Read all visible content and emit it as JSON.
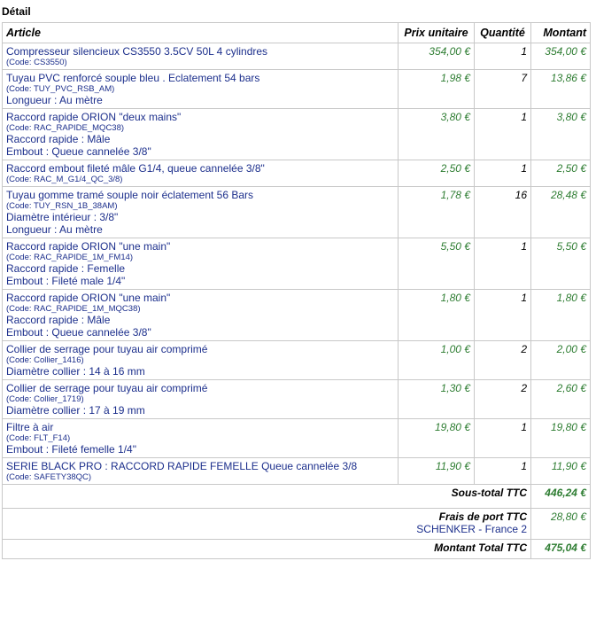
{
  "section_title": "Détail",
  "headers": {
    "article": "Article",
    "unit_price": "Prix unitaire",
    "quantity": "Quantité",
    "amount": "Montant"
  },
  "items": [
    {
      "name": "Compresseur silencieux CS3550 3.5CV 50L 4 cylindres",
      "code": "(Code: CS3550)",
      "attrs": [],
      "price": "354,00 €",
      "qty": "1",
      "amount": "354,00 €"
    },
    {
      "name": "Tuyau PVC renforcé souple bleu . Eclatement 54 bars",
      "code": "(Code: TUY_PVC_RSB_AM)",
      "attrs": [
        "Longueur : Au mètre"
      ],
      "price": "1,98 €",
      "qty": "7",
      "amount": "13,86 €"
    },
    {
      "name": "Raccord rapide ORION \"deux mains\"",
      "code": "(Code: RAC_RAPIDE_MQC38)",
      "attrs": [
        "Raccord rapide : Mâle",
        "Embout : Queue cannelée 3/8\""
      ],
      "price": "3,80 €",
      "qty": "1",
      "amount": "3,80 €"
    },
    {
      "name": "Raccord embout fileté mâle G1/4, queue cannelée 3/8\"",
      "code": "(Code: RAC_M_G1/4_QC_3/8)",
      "attrs": [],
      "price": "2,50 €",
      "qty": "1",
      "amount": "2,50 €"
    },
    {
      "name": "Tuyau gomme tramé souple noir éclatement 56 Bars",
      "code": "(Code: TUY_RSN_1B_38AM)",
      "attrs": [
        "Diamètre intérieur : 3/8\"",
        "Longueur : Au mètre"
      ],
      "price": "1,78 €",
      "qty": "16",
      "amount": "28,48 €"
    },
    {
      "name": "Raccord rapide ORION \"une main\"",
      "code": "(Code: RAC_RAPIDE_1M_FM14)",
      "attrs": [
        "Raccord rapide : Femelle",
        "Embout : Fileté male 1/4\""
      ],
      "price": "5,50 €",
      "qty": "1",
      "amount": "5,50 €"
    },
    {
      "name": "Raccord rapide ORION \"une main\"",
      "code": "(Code: RAC_RAPIDE_1M_MQC38)",
      "attrs": [
        "Raccord rapide : Mâle",
        "Embout : Queue cannelée 3/8\""
      ],
      "price": "1,80 €",
      "qty": "1",
      "amount": "1,80 €"
    },
    {
      "name": "Collier de serrage pour tuyau air comprimé",
      "code": "(Code: Collier_1416)",
      "attrs": [
        "Diamètre collier : 14 à 16 mm"
      ],
      "price": "1,00 €",
      "qty": "2",
      "amount": "2,00 €"
    },
    {
      "name": "Collier de serrage pour tuyau air comprimé",
      "code": "(Code: Collier_1719)",
      "attrs": [
        "Diamètre collier : 17 à 19 mm"
      ],
      "price": "1,30 €",
      "qty": "2",
      "amount": "2,60 €"
    },
    {
      "name": "Filtre à air",
      "code": "(Code: FLT_F14)",
      "attrs": [
        "Embout : Fileté femelle 1/4\""
      ],
      "price": "19,80 €",
      "qty": "1",
      "amount": "19,80 €"
    },
    {
      "name": "SERIE BLACK PRO : RACCORD RAPIDE FEMELLE Queue cannelée 3/8",
      "code": "(Code: SAFETY38QC)",
      "attrs": [],
      "price": "11,90 €",
      "qty": "1",
      "amount": "11,90 €"
    }
  ],
  "subtotal": {
    "label": "Sous-total TTC",
    "value": "446,24 €"
  },
  "shipping": {
    "label": "Frais de port TTC",
    "carrier": "SCHENKER - France 2",
    "value": "28,80 €"
  },
  "total": {
    "label": "Montant Total TTC",
    "value": "475,04 €"
  },
  "colors": {
    "link_blue": "#1c2f8c",
    "amount_green": "#2e7d32",
    "border": "#c8c8c8"
  }
}
